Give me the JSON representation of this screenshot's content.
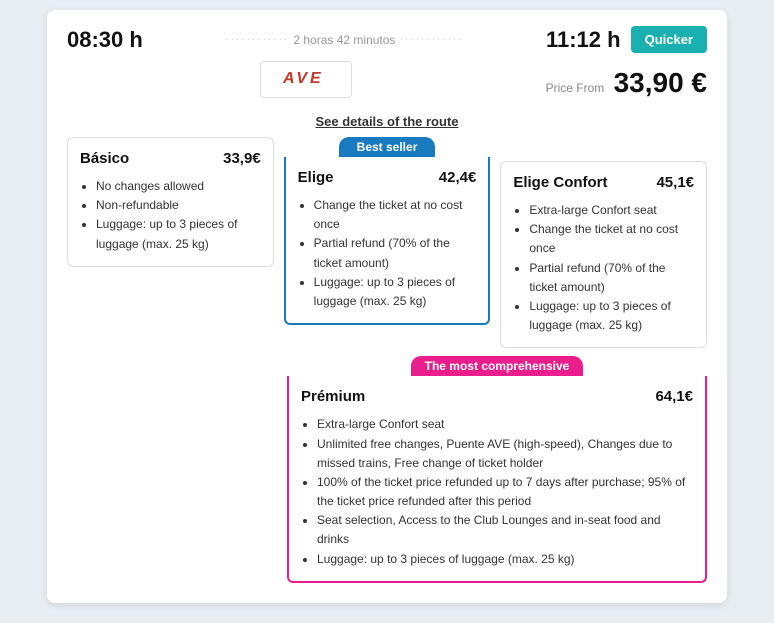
{
  "header": {
    "time_departure": "08:30 h",
    "duration_text": "2 horas 42 minutos",
    "time_arrival": "11:12 h",
    "quicker_label": "Quicker",
    "price_from_label": "Price From",
    "price": "33,90 €",
    "ave_logo": "AVE",
    "see_details": "See details of the route"
  },
  "badges": {
    "best_seller": "Best seller",
    "most_comprehensive": "The most comprehensive"
  },
  "plans": {
    "basico": {
      "name": "Básico",
      "price": "33,9€",
      "features": [
        "No changes allowed",
        "Non-refundable",
        "Luggage: up to 3 pieces of luggage (max. 25 kg)"
      ]
    },
    "elige": {
      "name": "Elige",
      "price": "42,4€",
      "features": [
        "Change the ticket at no cost once",
        "Partial refund (70% of the ticket amount)",
        "Luggage: up to 3 pieces of luggage (max. 25 kg)"
      ]
    },
    "elige_confort": {
      "name": "Elige Confort",
      "price": "45,1€",
      "features": [
        "Extra-large Confort seat",
        "Change the ticket at no cost once",
        "Partial refund (70% of the ticket amount)",
        "Luggage: up to 3 pieces of luggage (max. 25 kg)"
      ]
    },
    "premium": {
      "name": "Prémium",
      "price": "64,1€",
      "features": [
        "Extra-large Confort seat",
        "Unlimited free changes, Puente AVE (high-speed), Changes due to missed trains, Free change of ticket holder",
        "100% of the ticket price refunded up to 7 days after purchase; 95% of the ticket price refunded after this period",
        "Seat selection, Access to the Club Lounges and in-seat food and drinks",
        "Luggage: up to 3 pieces of luggage (max. 25 kg)"
      ]
    }
  }
}
